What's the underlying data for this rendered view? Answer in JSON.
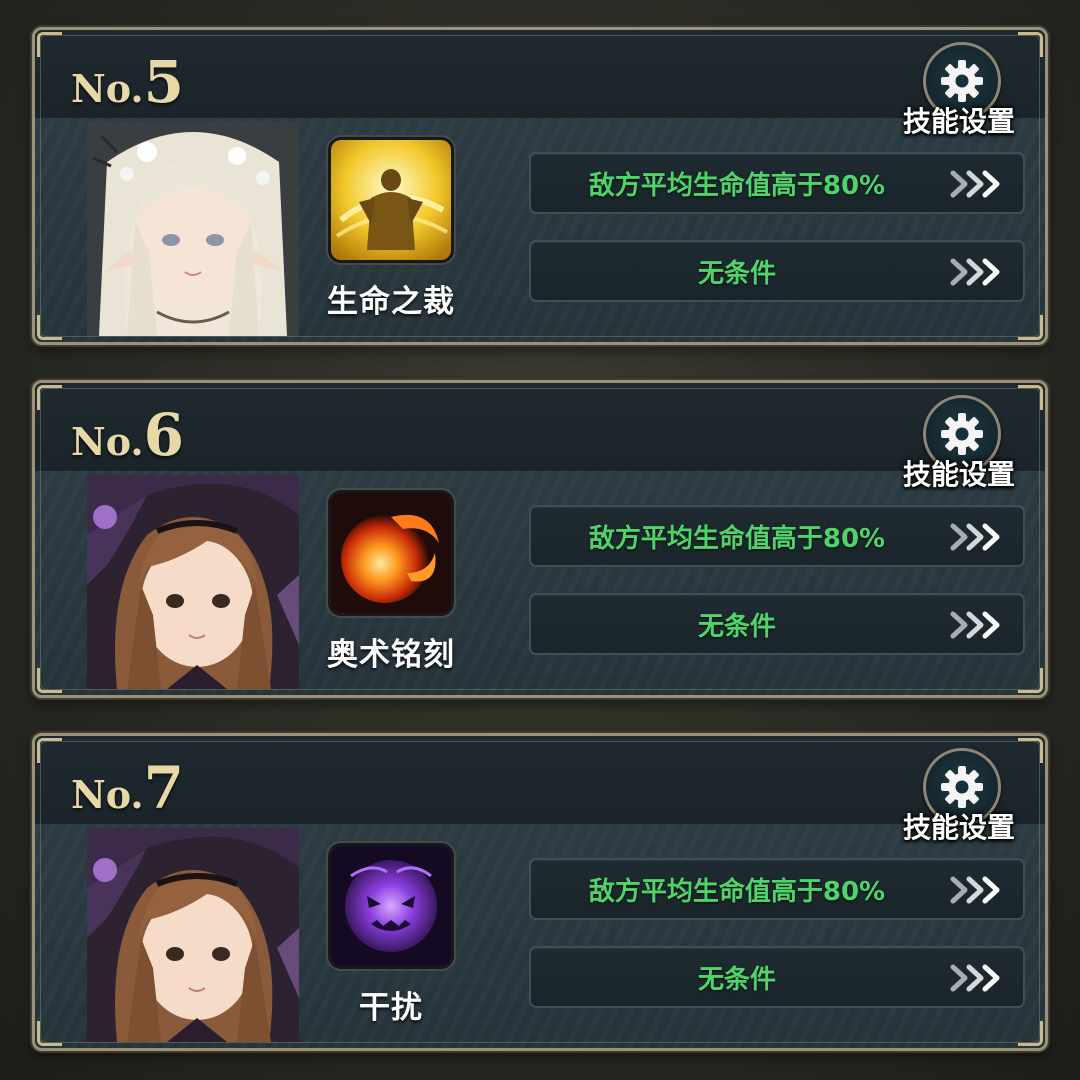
{
  "cards": [
    {
      "rank_prefix": "No.",
      "rank_number": "5",
      "skill_name": "生命之裁",
      "skill_icon": "golden-warrior-icon",
      "settings_label": "技能设置",
      "conditions": [
        "敌方平均生命值高于80%",
        "无条件"
      ]
    },
    {
      "rank_prefix": "No.",
      "rank_number": "6",
      "skill_name": "奥术铭刻",
      "skill_icon": "fireball-icon",
      "settings_label": "技能设置",
      "conditions": [
        "敌方平均生命值高于80%",
        "无条件"
      ]
    },
    {
      "rank_prefix": "No.",
      "rank_number": "7",
      "skill_name": "干扰",
      "skill_icon": "purple-shadow-icon",
      "settings_label": "技能设置",
      "conditions": [
        "敌方平均生命值高于80%",
        "无条件"
      ]
    }
  ],
  "colors": {
    "condition_text": "#4fd46c",
    "frame": "#9c9278",
    "rank_text": "#e8d8a8"
  }
}
